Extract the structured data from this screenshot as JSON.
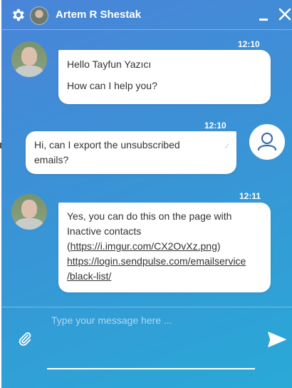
{
  "header": {
    "name": "Artem R Shestak",
    "settings_icon": "gear-icon",
    "minimize_icon": "minimize-icon",
    "close_icon": "close-icon"
  },
  "messages": [
    {
      "time": "12:10",
      "lines": [
        "Hello Tayfun Yazıcı",
        "How can I help you?"
      ]
    },
    {
      "time": "12:10",
      "lines": [
        "Hi, can I export the unsubscribed",
        "emails?"
      ]
    },
    {
      "time": "12:11",
      "lines": [
        "Yes, you can do this on the page with",
        "Inactive contacts",
        "(",
        "https://i.imgur.com/CX2OvXz.png",
        ")",
        "https://login.sendpulse.com/emailservice",
        "/black-list/"
      ]
    }
  ],
  "composer": {
    "placeholder": "Type your message here ..."
  },
  "colors": {
    "gradient_start": "#4a84d8",
    "gradient_end": "#29a9d6",
    "bubble": "#ffffff",
    "text": "#333333"
  }
}
